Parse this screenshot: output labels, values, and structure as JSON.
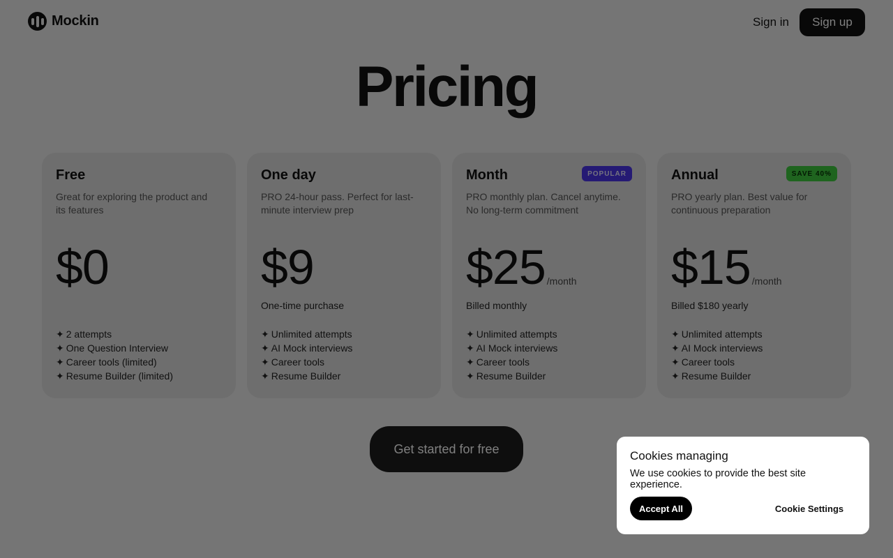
{
  "header": {
    "brand": "Mockin",
    "signin_label": "Sign in",
    "signup_label": "Sign up"
  },
  "page_title": "Pricing",
  "plans": [
    {
      "name": "Free",
      "description": "Great for exploring the product and its features",
      "price": "$0",
      "period": "",
      "billing": "",
      "badge": "",
      "features": [
        "2 attempts",
        "One Question Interview",
        "Career tools (limited)",
        "Resume Builder (limited)"
      ]
    },
    {
      "name": "One day",
      "description": "PRO 24-hour pass. Perfect for last-minute interview prep",
      "price": "$9",
      "period": "",
      "billing": "One-time purchase",
      "badge": "",
      "features": [
        "Unlimited attempts",
        "AI Mock interviews",
        "Career tools",
        "Resume Builder"
      ]
    },
    {
      "name": "Month",
      "description": "PRO monthly plan. Cancel anytime. No long-term commitment",
      "price": "$25",
      "period": "/month",
      "billing": "Billed monthly",
      "badge": "POPULAR",
      "features": [
        "Unlimited attempts",
        "AI Mock interviews",
        "Career tools",
        "Resume Builder"
      ]
    },
    {
      "name": "Annual",
      "description": "PRO yearly plan. Best value for continuous preparation",
      "price": "$15",
      "period": "/month",
      "billing": "Billed $180 yearly",
      "badge": "SAVE 40%",
      "features": [
        "Unlimited attempts",
        "AI Mock interviews",
        "Career tools",
        "Resume Builder"
      ]
    }
  ],
  "feature_bullet": "✦",
  "cta_label": "Get started for free",
  "cookie": {
    "title": "Cookies managing",
    "text": "We use cookies to provide the best site experience.",
    "accept_label": "Accept All",
    "settings_label": "Cookie Settings"
  },
  "colors": {
    "popular_badge": "#4a35e8",
    "save_badge": "#3ec93e",
    "overlay": "rgba(0,0,0,0.5)"
  }
}
